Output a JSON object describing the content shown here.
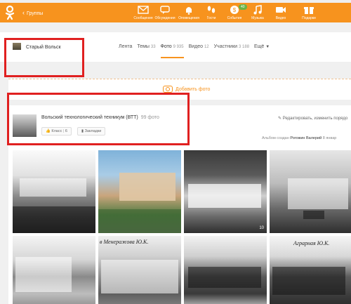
{
  "topbar": {
    "back_label": "Группы",
    "nav": [
      {
        "icon": "mail-icon",
        "label": "Сообщения"
      },
      {
        "icon": "discussions-icon",
        "label": "Обсуждения"
      },
      {
        "icon": "bell-icon",
        "label": "Оповещения"
      },
      {
        "icon": "footprints-icon",
        "label": "Гости"
      },
      {
        "icon": "events-icon",
        "label": "События",
        "badge": "40"
      },
      {
        "icon": "music-icon",
        "label": "Музыка"
      },
      {
        "icon": "video-icon",
        "label": "Видео"
      },
      {
        "icon": "gift-icon",
        "label": "Подарки"
      }
    ]
  },
  "group": {
    "name": "Старый Вольск",
    "tabs": [
      {
        "label": "Лента",
        "count": ""
      },
      {
        "label": "Темы",
        "count": "33"
      },
      {
        "label": "Фото",
        "count": "9 935"
      },
      {
        "label": "Видео",
        "count": "12"
      },
      {
        "label": "Участники",
        "count": "3 188"
      },
      {
        "label": "Ещё",
        "count": ""
      }
    ]
  },
  "add_photo": {
    "label": "Добавить фото"
  },
  "album": {
    "title": "Вольский технологический техникум (ВТТ)",
    "count": "99 фото",
    "like_label": "Класс",
    "like_count": "6",
    "bookmark_label": "Закладки",
    "edit_label": "Редактировать, изменить порядо",
    "created_prefix": "Альбом создан",
    "created_by": "Рогожин Валерий",
    "created_suffix": "8 январ",
    "photo_overlay": "10",
    "captions": {
      "p6": "в Менеражова Ю.К.",
      "p8": "Аграрная Ю.К."
    }
  },
  "colors": {
    "accent": "#f7931e",
    "badge": "#6ab344",
    "highlight": "#e02020"
  }
}
